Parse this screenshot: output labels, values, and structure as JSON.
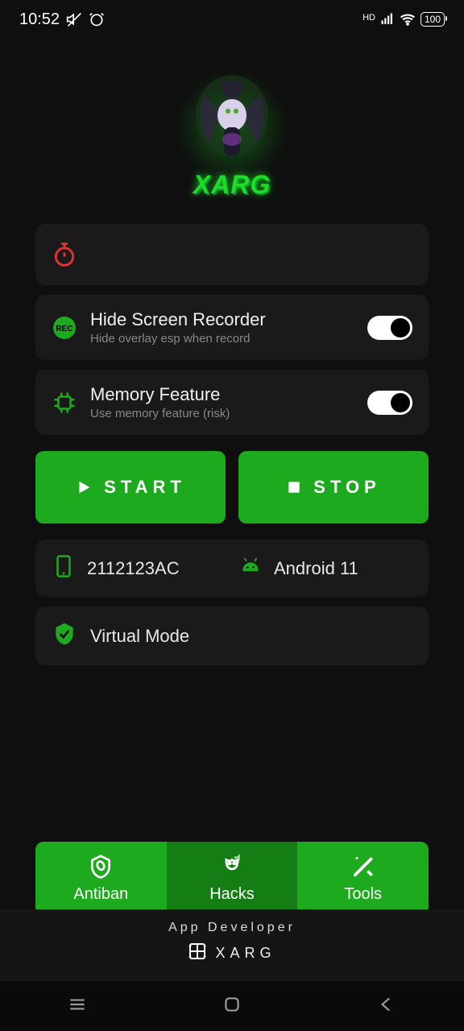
{
  "status": {
    "time": "10:52",
    "hd_label": "HD",
    "battery": "100"
  },
  "logo": {
    "text": "XARG"
  },
  "settings": {
    "hide_recorder": {
      "title": "Hide Screen Recorder",
      "sub": "Hide overlay esp when record"
    },
    "memory": {
      "title": "Memory Feature",
      "sub": "Use memory feature (risk)"
    }
  },
  "buttons": {
    "start": "START",
    "stop": "STOP"
  },
  "device": {
    "model": "2112123AC",
    "os": "Android 11",
    "mode": "Virtual Mode"
  },
  "tabs": {
    "antiban": "Antiban",
    "hacks": "Hacks",
    "tools": "Tools"
  },
  "footer": {
    "title": "App Developer",
    "brand": "XARG"
  }
}
